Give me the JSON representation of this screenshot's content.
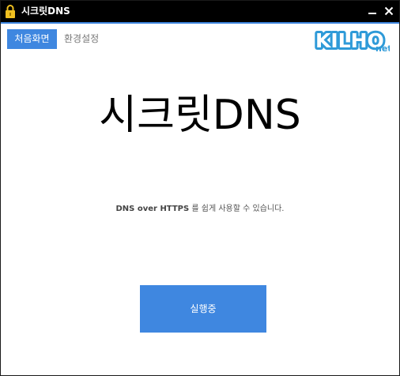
{
  "window": {
    "title": "시크릿DNS"
  },
  "nav": {
    "home_label": "처음화면",
    "settings_label": "환경설정"
  },
  "logo": {
    "main_text": "KILHO",
    "suffix_text": "net"
  },
  "main": {
    "heading": "시크릿DNS",
    "description_emphasis": "DNS over HTTPS",
    "description_rest": " 를 쉽게 사용할 수 있습니다.",
    "run_button_label": "실행중"
  },
  "colors": {
    "accent": "#3f87e0",
    "titlebar": "#000000"
  },
  "icons": [
    "lock-icon",
    "minimize-icon",
    "close-icon"
  ]
}
